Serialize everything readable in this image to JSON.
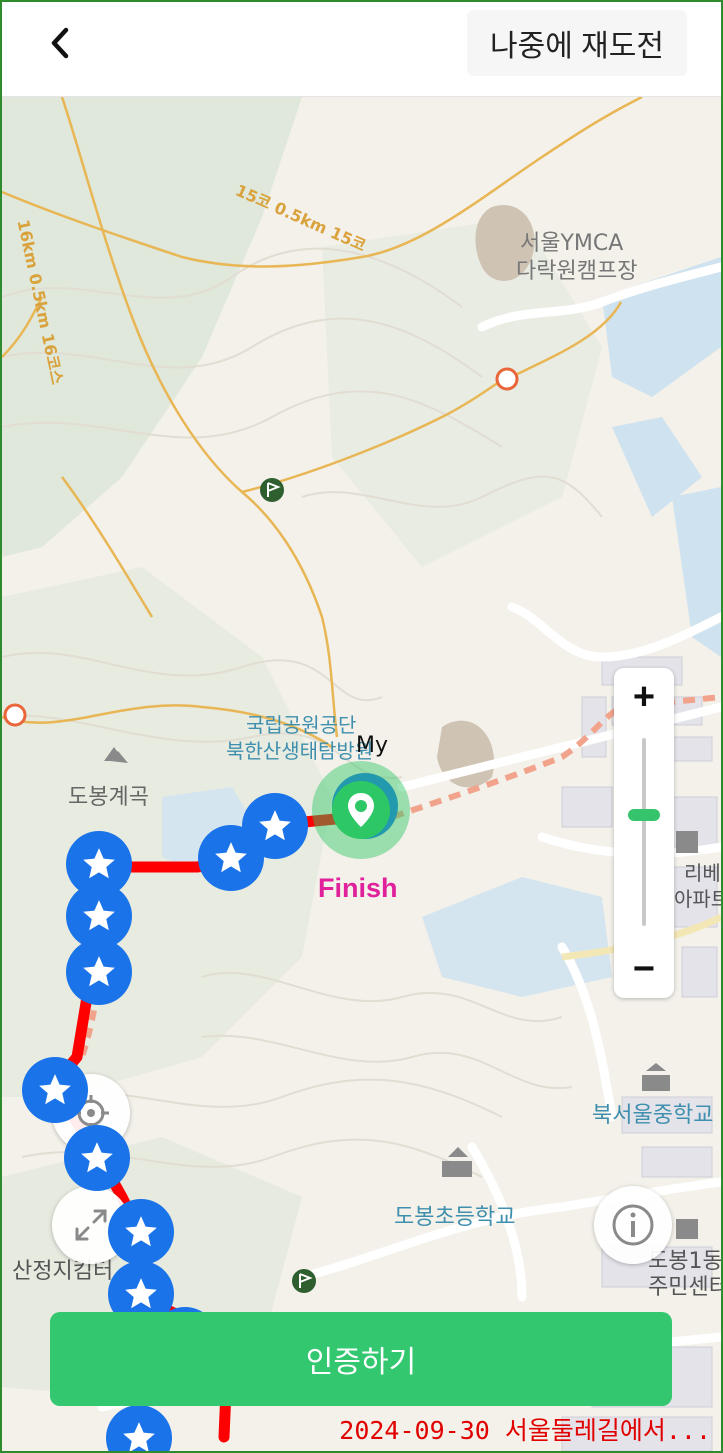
{
  "header": {
    "back_icon": "chevron-left-icon",
    "retry_label": "나중에 재도전"
  },
  "map": {
    "labels": {
      "ymca_line1": "서울YMCA",
      "ymca_line2": "다락원캠프장",
      "park_line1": "국립공원공단",
      "park_line2": "북한산생태탐방원",
      "dobong_valley": "도봉계곡",
      "north_seoul_school": "북서울중학교",
      "dobong_elementary": "도봉초등학교",
      "sanjeong_center": "산정지킴터",
      "dobong1_line1": "도봉1동",
      "dobong1_line2": "주민센터",
      "apt_line1": "리베",
      "apt_line2": "아파트",
      "trail_1": "16km 0.5km 16코스",
      "trail_2": "15코 0.5km 15코"
    },
    "my_label": "My",
    "finish_label": "Finish",
    "route_color": "#ff0000",
    "stamp_color": "#1a73e8",
    "finish_color": "#2ec766",
    "finish_label_color": "#e0219b"
  },
  "controls": {
    "zoom_in": "+",
    "zoom_out": "−",
    "zoom_level": 0.38,
    "locate_icon": "crosshair-icon",
    "expand_icon": "expand-icon",
    "info_icon": "info-icon"
  },
  "verify_button": "인증하기",
  "footer_stamp": "2024-09-30 서울둘레길에서..."
}
